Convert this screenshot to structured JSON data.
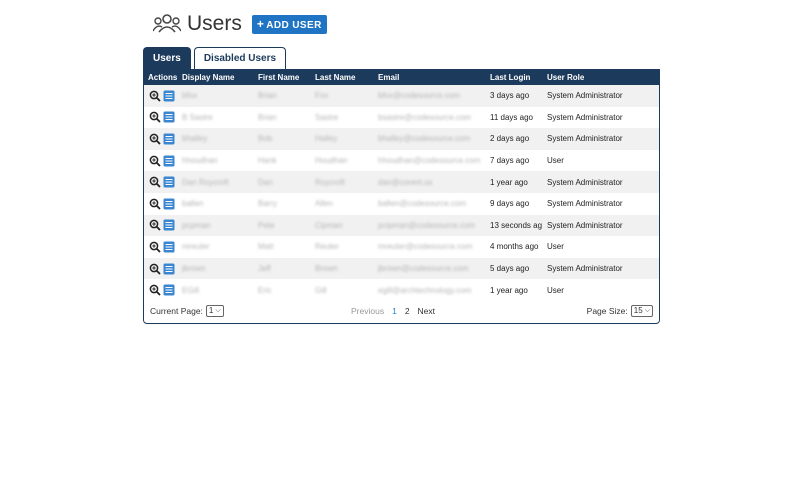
{
  "header": {
    "title": "Users",
    "add_button_plus": "+",
    "add_button_label": "ADD USER"
  },
  "tabs": [
    {
      "label": "Users",
      "active": true
    },
    {
      "label": "Disabled Users",
      "active": false
    }
  ],
  "table": {
    "columns": [
      "Actions",
      "Display Name",
      "First Name",
      "Last Name",
      "Email",
      "Last Login",
      "User Role"
    ],
    "rows": [
      {
        "display_name": "bfox",
        "first_name": "Brian",
        "last_name": "Fox",
        "email": "bfox@codesource.com",
        "last_login": "3 days ago",
        "role": "System Administrator"
      },
      {
        "display_name": "B Sastre",
        "first_name": "Brian",
        "last_name": "Sastre",
        "email": "bsastre@codesource.com",
        "last_login": "11 days ago",
        "role": "System Administrator"
      },
      {
        "display_name": "bhalley",
        "first_name": "Bob",
        "last_name": "Halley",
        "email": "bhalley@codesource.com",
        "last_login": "2 days ago",
        "role": "System Administrator"
      },
      {
        "display_name": "hhoudhan",
        "first_name": "Hank",
        "last_name": "Houdhan",
        "email": "hhoudhan@codesource.com",
        "last_login": "7 days ago",
        "role": "User"
      },
      {
        "display_name": "Dan Roycroft",
        "first_name": "Dan",
        "last_name": "Roycroft",
        "email": "dan@corent.us",
        "last_login": "1 year ago",
        "role": "System Administrator"
      },
      {
        "display_name": "ballen",
        "first_name": "Barry",
        "last_name": "Allen",
        "email": "ballen@codesource.com",
        "last_login": "9 days ago",
        "role": "System Administrator"
      },
      {
        "display_name": "pcpman",
        "first_name": "Pete",
        "last_name": "Cipman",
        "email": "pcipman@codesource.com",
        "last_login": "13 seconds ag",
        "role": "System Administrator"
      },
      {
        "display_name": "mreuter",
        "first_name": "Matt",
        "last_name": "Reuter",
        "email": "mreuter@codesource.com",
        "last_login": "4 months ago",
        "role": "User"
      },
      {
        "display_name": "jbrown",
        "first_name": "Jeff",
        "last_name": "Brown",
        "email": "jbrown@codesource.com",
        "last_login": "5 days ago",
        "role": "System Administrator"
      },
      {
        "display_name": "EGill",
        "first_name": "Eric",
        "last_name": "Gill",
        "email": "egill@archtechnology.com",
        "last_login": "1 year ago",
        "role": "User"
      }
    ]
  },
  "footer": {
    "current_page_label": "Current Page:",
    "current_page_value": "1",
    "previous": "Previous",
    "pages": [
      "1",
      "2"
    ],
    "next": "Next",
    "page_size_label": "Page Size:",
    "page_size_value": "15"
  },
  "colors": {
    "header_bg": "#1c3a5c",
    "accent": "#1f74c4",
    "active_page": "#2a7fd4"
  },
  "icons": {
    "title": "users-icon",
    "view": "magnify-plus-icon",
    "edit": "edit-list-icon"
  }
}
